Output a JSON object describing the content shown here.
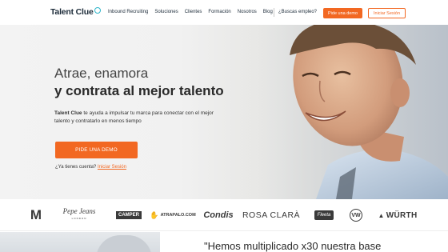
{
  "header": {
    "logo_text": "Talent Clue",
    "nav": [
      "Inbound Recruiting",
      "Soluciones",
      "Clientes",
      "Formación",
      "Nosotros",
      "Blog"
    ],
    "jobs_link": "¿Buscas empleo?",
    "demo_button": "Pide una demo",
    "login_button": "Iniciar Sesión"
  },
  "hero": {
    "title_line1": "Atrae, enamora",
    "title_line2": "y contrata al mejor talento",
    "subtitle_brand": "Talent Clue",
    "subtitle_rest": " te ayuda a impulsar tu marca para conectar con el mejor talento y contratarlo en menos tiempo",
    "cta_button": "PIDE UNA DEMO",
    "account_question": "¿Ya tienes cuenta?",
    "account_link": "Iniciar Sesión"
  },
  "client_logos": [
    {
      "name": "McDonald's",
      "text": "M"
    },
    {
      "name": "Pepe Jeans",
      "text": "Pepe Jeans",
      "sub": "LONDON"
    },
    {
      "name": "Camper",
      "text": "CAMPER"
    },
    {
      "name": "Atrapalo",
      "text": "ATRAPALO.COM"
    },
    {
      "name": "Condis",
      "text": "Condis"
    },
    {
      "name": "Rosa Clara",
      "text": "ROSA CLARÀ"
    },
    {
      "name": "Fleeta",
      "text": "Fleeta"
    },
    {
      "name": "Volkswagen",
      "text": "VW"
    },
    {
      "name": "Wurth",
      "text": "WÜRTH"
    }
  ],
  "testimonial": {
    "quote_start": "\"Hemos multiplicado x30 nuestra base"
  },
  "colors": {
    "accent": "#f26822",
    "logo_ring": "#2eb5c9",
    "text_dark": "#2a2a2a"
  }
}
